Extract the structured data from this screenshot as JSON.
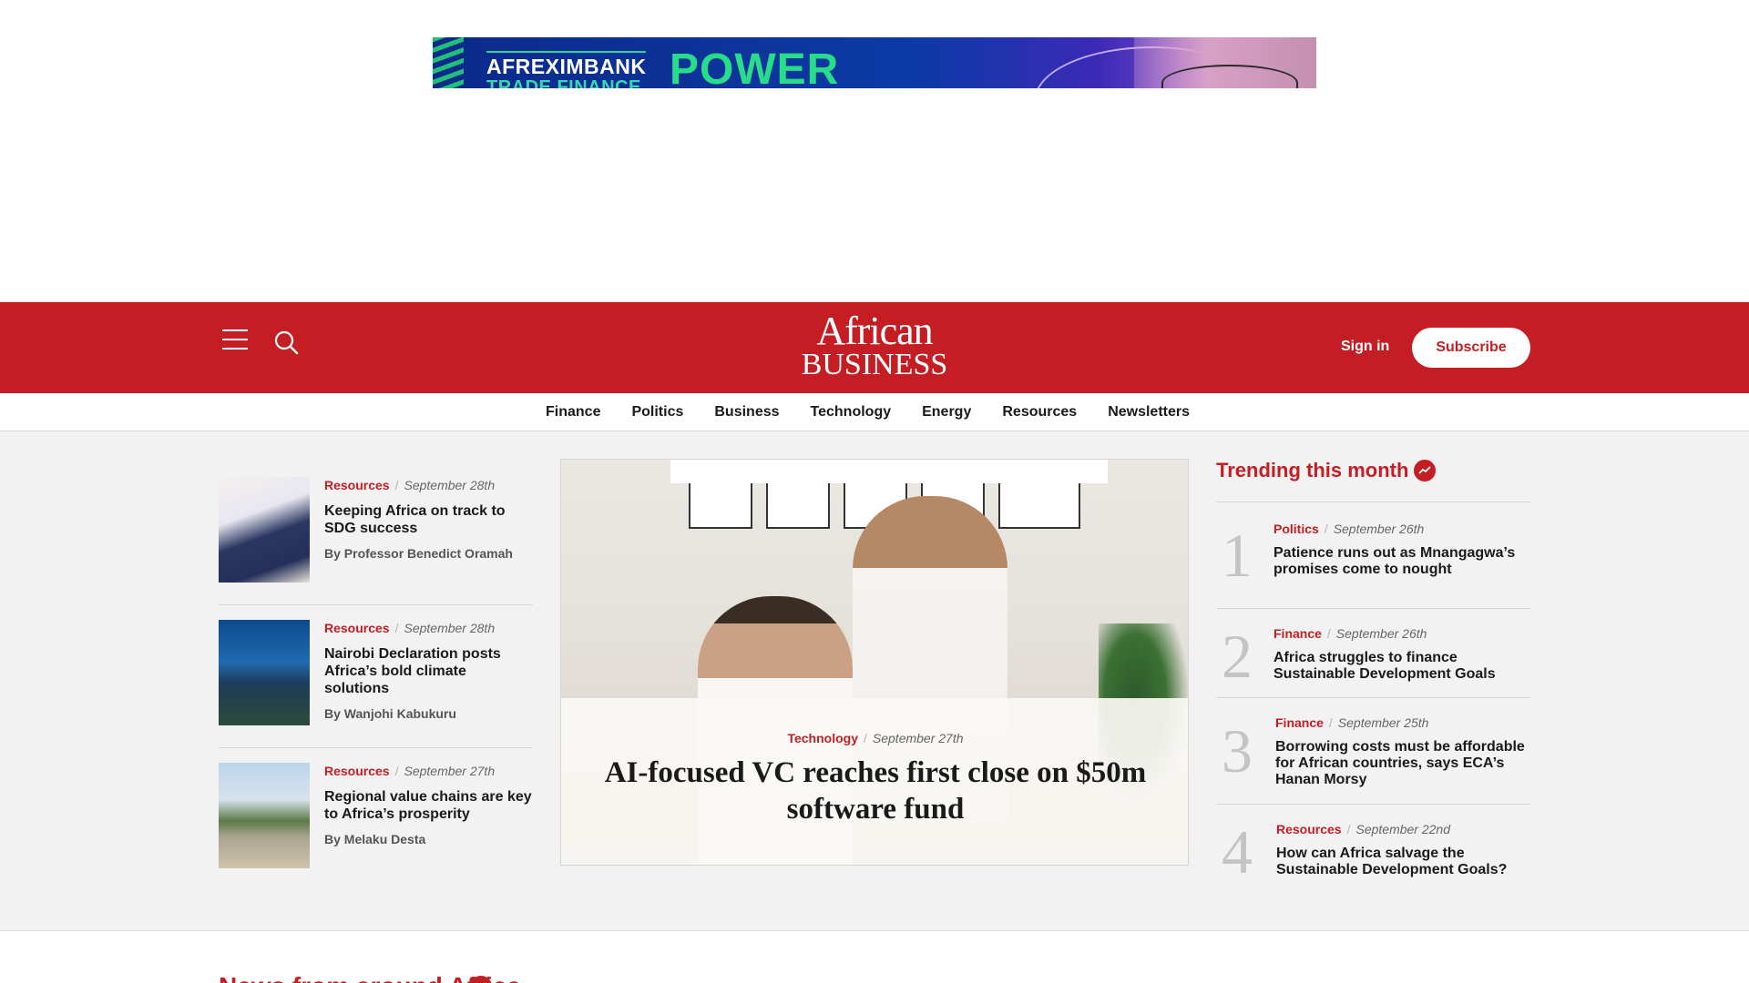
{
  "ad": {
    "brand": "AFREXIMBANK",
    "sub": "TRADE FINANCE",
    "headline": "POWER"
  },
  "header": {
    "logo_line1": "African",
    "logo_line2": "BUSINESS",
    "signin_label": "Sign in",
    "subscribe_label": "Subscribe",
    "brand_color": "#c41e24"
  },
  "nav": {
    "items": [
      "Finance",
      "Politics",
      "Business",
      "Technology",
      "Energy",
      "Resources",
      "Newsletters"
    ]
  },
  "side_articles": [
    {
      "category": "Resources",
      "date": "September 28th",
      "title": "Keeping Africa on track to SDG success",
      "byline": "By Professor Benedict Oramah"
    },
    {
      "category": "Resources",
      "date": "September 28th",
      "title": "Nairobi Declaration posts Africa’s bold climate solutions",
      "byline": "By Wanjohi Kabukuru"
    },
    {
      "category": "Resources",
      "date": "September 27th",
      "title": "Regional value chains are key to Africa’s prosperity",
      "byline": "By Melaku Desta"
    }
  ],
  "hero": {
    "category": "Technology",
    "date": "September 27th",
    "title": "AI-focused VC reaches first close on $50m software fund"
  },
  "trending": {
    "title": "Trending this month",
    "items": [
      {
        "rank": "1",
        "category": "Politics",
        "date": "September 26th",
        "title": "Patience runs out as Mnangagwa’s promises come to nought"
      },
      {
        "rank": "2",
        "category": "Finance",
        "date": "September 26th",
        "title": "Africa struggles to finance Sustainable Development Goals"
      },
      {
        "rank": "3",
        "category": "Finance",
        "date": "September 25th",
        "title": "Borrowing costs must be affordable for African countries, says ECA’s Hanan Morsy"
      },
      {
        "rank": "4",
        "category": "Resources",
        "date": "September 22nd",
        "title": "How can Africa salvage the Sustainable Development Goals?"
      }
    ]
  },
  "section": {
    "heading": "News from around Africa"
  }
}
